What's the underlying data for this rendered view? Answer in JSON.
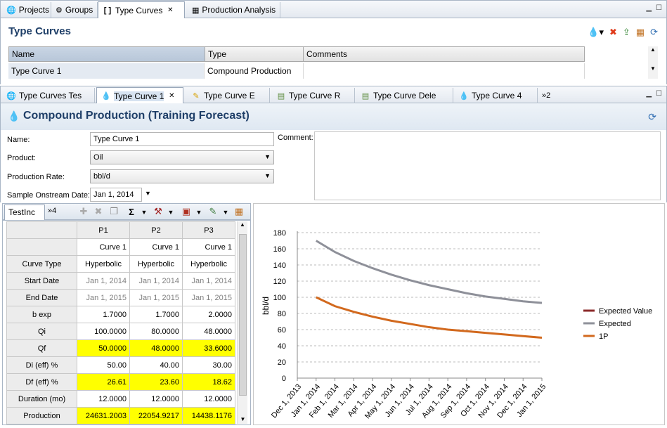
{
  "top_tabs": [
    {
      "label": "Projects",
      "icon": "projects-icon"
    },
    {
      "label": "Groups",
      "icon": "groups-icon"
    },
    {
      "label": "Type Curves",
      "icon": "bracket-icon",
      "active": true
    },
    {
      "label": "Production Analysis",
      "icon": "chart-icon"
    }
  ],
  "type_curves_panel": {
    "title": "Type Curves",
    "columns": [
      "Name",
      "Type",
      "Comments"
    ],
    "rows": [
      {
        "name": "Type Curve 1",
        "type": "Compound Production",
        "comments": ""
      }
    ]
  },
  "doc_tabs": [
    {
      "label": "Type Curves Tes",
      "icon": "db-icon"
    },
    {
      "label": "Type Curve 1",
      "icon": "drop-icon",
      "active": true
    },
    {
      "label": "Type Curve E",
      "icon": "pencil-icon"
    },
    {
      "label": "Type Curve R",
      "icon": "money-icon"
    },
    {
      "label": "Type Curve Dele",
      "icon": "money-icon"
    },
    {
      "label": "Type Curve 4",
      "icon": "drop-icon"
    }
  ],
  "doc_overflow": "»2",
  "editor": {
    "title": "Compound Production (Training Forecast)",
    "name_label": "Name:",
    "name_value": "Type Curve 1",
    "product_label": "Product:",
    "product_value": "Oil",
    "rate_label": "Production Rate:",
    "rate_value": "bbl/d",
    "onstream_label": "Sample Onstream Date:",
    "onstream_value": "Jan 1, 2014",
    "comment_label": "Comment:"
  },
  "grid_tab": {
    "label": "TestInc",
    "overflow": "»4"
  },
  "table": {
    "headers": [
      "P1",
      "P2",
      "P3"
    ],
    "subheaders": [
      "Curve 1",
      "Curve 1",
      "Curve 1"
    ],
    "rows": [
      {
        "label": "Curve Type",
        "values": [
          "Hyperbolic",
          "Hyperbolic",
          "Hyperbolic"
        ],
        "style": "center"
      },
      {
        "label": "Start Date",
        "values": [
          "Jan 1, 2014",
          "Jan 1, 2014",
          "Jan 1, 2014"
        ],
        "style": "gray"
      },
      {
        "label": "End Date",
        "values": [
          "Jan 1, 2015",
          "Jan 1, 2015",
          "Jan 1, 2015"
        ],
        "style": "gray"
      },
      {
        "label": "b exp",
        "values": [
          "1.7000",
          "1.7000",
          "2.0000"
        ],
        "style": "num"
      },
      {
        "label": "Qi",
        "values": [
          "100.0000",
          "80.0000",
          "48.0000"
        ],
        "style": "num"
      },
      {
        "label": "Qf",
        "values": [
          "50.0000",
          "48.0000",
          "33.6000"
        ],
        "style": "yel"
      },
      {
        "label": "Di (eff) %",
        "values": [
          "50.00",
          "40.00",
          "30.00"
        ],
        "style": "num"
      },
      {
        "label": "Df (eff) %",
        "values": [
          "26.61",
          "23.60",
          "18.62"
        ],
        "style": "yel"
      },
      {
        "label": "Duration (mo)",
        "values": [
          "12.0000",
          "12.0000",
          "12.0000"
        ],
        "style": "num"
      },
      {
        "label": "Production",
        "values": [
          "24631.2003",
          "22054.9217",
          "14438.1176"
        ],
        "style": "yel"
      }
    ]
  },
  "colors": {
    "expected_value": "#8b2a2a",
    "expected": "#8e9099",
    "one_p": "#d2691e",
    "highlight": "#ffff00",
    "title": "#1f3f68"
  },
  "chart_data": {
    "type": "line",
    "ylabel": "bbl/d",
    "ylim": [
      0,
      180
    ],
    "yticks": [
      0,
      20,
      40,
      60,
      80,
      100,
      120,
      140,
      160,
      180
    ],
    "categories": [
      "Dec 1, 2013",
      "Jan 1, 2014",
      "Feb 1, 2014",
      "Mar 1, 2014",
      "Apr 1, 2014",
      "May 1, 2014",
      "Jun 1, 2014",
      "Jul 1, 2014",
      "Aug 1, 2014",
      "Sep 1, 2014",
      "Oct 1, 2014",
      "Nov 1, 2014",
      "Dec 1, 2014",
      "Jan 1, 2015"
    ],
    "legend_position": "right",
    "grid": true,
    "series": [
      {
        "name": "Expected Value",
        "values": []
      },
      {
        "name": "Expected",
        "values": [
          null,
          170,
          156,
          145,
          136,
          128,
          121,
          115,
          110,
          105,
          101,
          98,
          95,
          93
        ]
      },
      {
        "name": "1P",
        "values": [
          null,
          100,
          89,
          82,
          76,
          71,
          67,
          63,
          60,
          58,
          56,
          54,
          52,
          50
        ]
      }
    ]
  }
}
